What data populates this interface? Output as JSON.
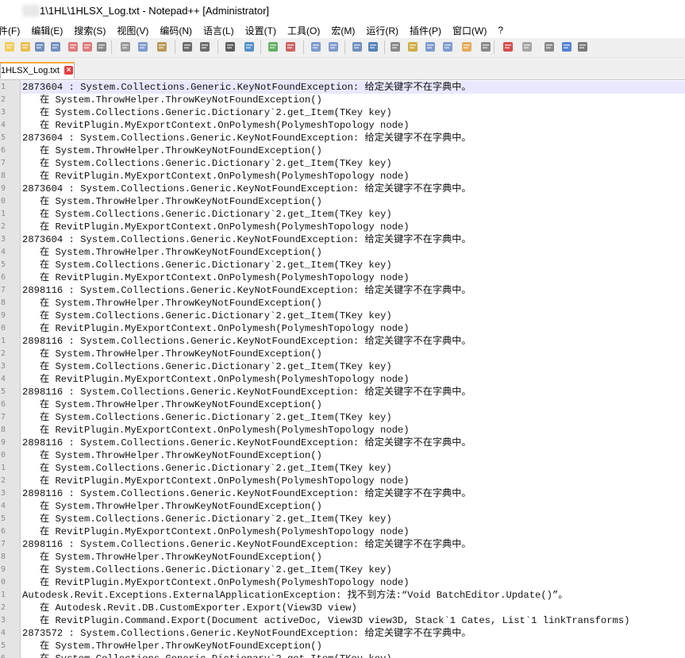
{
  "window": {
    "title": "1\\1HL\\1HLSX_Log.txt - Notepad++ [Administrator]"
  },
  "menu": [
    "件(F)",
    "编辑(E)",
    "搜索(S)",
    "视图(V)",
    "编码(N)",
    "语言(L)",
    "设置(T)",
    "工具(O)",
    "宏(M)",
    "运行(R)",
    "插件(P)",
    "窗口(W)",
    "?"
  ],
  "toolbar": {
    "icons": [
      "new-file-icon",
      "open-file-icon",
      "save-icon",
      "save-all-icon",
      "close-icon",
      "close-all-icon",
      "print-icon",
      "cut-icon",
      "copy-icon",
      "paste-icon",
      "undo-icon",
      "redo-icon",
      "find-icon",
      "replace-icon",
      "zoom-in-icon",
      "zoom-out-icon",
      "sync-vertical-icon",
      "sync-horizontal-icon",
      "word-wrap-icon",
      "show-all-chars-icon",
      "indent-guide-icon",
      "udl-icon",
      "doc-map-icon",
      "function-list-icon",
      "folder-workspace-icon",
      "monitor-icon",
      "record-macro-icon",
      "stop-macro-icon",
      "play-macro-icon",
      "run-macro-multiple-icon",
      "save-macro-icon"
    ]
  },
  "tab": {
    "label": "1HLSX_Log.txt",
    "close_symbol": "×"
  },
  "editor": {
    "lines": [
      {
        "n": "1",
        "text": "2873604 : System.Collections.Generic.KeyNotFoundException: 给定关键字不在字典中。"
      },
      {
        "n": "2",
        "text": "   在 System.ThrowHelper.ThrowKeyNotFoundException()"
      },
      {
        "n": "3",
        "text": "   在 System.Collections.Generic.Dictionary`2.get_Item(TKey key)"
      },
      {
        "n": "4",
        "text": "   在 RevitPlugin.MyExportContext.OnPolymesh(PolymeshTopology node)"
      },
      {
        "n": "5",
        "text": "2873604 : System.Collections.Generic.KeyNotFoundException: 给定关键字不在字典中。"
      },
      {
        "n": "6",
        "text": "   在 System.ThrowHelper.ThrowKeyNotFoundException()"
      },
      {
        "n": "7",
        "text": "   在 System.Collections.Generic.Dictionary`2.get_Item(TKey key)"
      },
      {
        "n": "8",
        "text": "   在 RevitPlugin.MyExportContext.OnPolymesh(PolymeshTopology node)"
      },
      {
        "n": "9",
        "text": "2873604 : System.Collections.Generic.KeyNotFoundException: 给定关键字不在字典中。"
      },
      {
        "n": "0",
        "text": "   在 System.ThrowHelper.ThrowKeyNotFoundException()"
      },
      {
        "n": "1",
        "text": "   在 System.Collections.Generic.Dictionary`2.get_Item(TKey key)"
      },
      {
        "n": "2",
        "text": "   在 RevitPlugin.MyExportContext.OnPolymesh(PolymeshTopology node)"
      },
      {
        "n": "3",
        "text": "2873604 : System.Collections.Generic.KeyNotFoundException: 给定关键字不在字典中。"
      },
      {
        "n": "4",
        "text": "   在 System.ThrowHelper.ThrowKeyNotFoundException()"
      },
      {
        "n": "5",
        "text": "   在 System.Collections.Generic.Dictionary`2.get_Item(TKey key)"
      },
      {
        "n": "6",
        "text": "   在 RevitPlugin.MyExportContext.OnPolymesh(PolymeshTopology node)"
      },
      {
        "n": "7",
        "text": "2898116 : System.Collections.Generic.KeyNotFoundException: 给定关键字不在字典中。"
      },
      {
        "n": "8",
        "text": "   在 System.ThrowHelper.ThrowKeyNotFoundException()"
      },
      {
        "n": "9",
        "text": "   在 System.Collections.Generic.Dictionary`2.get_Item(TKey key)"
      },
      {
        "n": "0",
        "text": "   在 RevitPlugin.MyExportContext.OnPolymesh(PolymeshTopology node)"
      },
      {
        "n": "1",
        "text": "2898116 : System.Collections.Generic.KeyNotFoundException: 给定关键字不在字典中。"
      },
      {
        "n": "2",
        "text": "   在 System.ThrowHelper.ThrowKeyNotFoundException()"
      },
      {
        "n": "3",
        "text": "   在 System.Collections.Generic.Dictionary`2.get_Item(TKey key)"
      },
      {
        "n": "4",
        "text": "   在 RevitPlugin.MyExportContext.OnPolymesh(PolymeshTopology node)"
      },
      {
        "n": "5",
        "text": "2898116 : System.Collections.Generic.KeyNotFoundException: 给定关键字不在字典中。"
      },
      {
        "n": "6",
        "text": "   在 System.ThrowHelper.ThrowKeyNotFoundException()"
      },
      {
        "n": "7",
        "text": "   在 System.Collections.Generic.Dictionary`2.get_Item(TKey key)"
      },
      {
        "n": "8",
        "text": "   在 RevitPlugin.MyExportContext.OnPolymesh(PolymeshTopology node)"
      },
      {
        "n": "9",
        "text": "2898116 : System.Collections.Generic.KeyNotFoundException: 给定关键字不在字典中。"
      },
      {
        "n": "0",
        "text": "   在 System.ThrowHelper.ThrowKeyNotFoundException()"
      },
      {
        "n": "1",
        "text": "   在 System.Collections.Generic.Dictionary`2.get_Item(TKey key)"
      },
      {
        "n": "2",
        "text": "   在 RevitPlugin.MyExportContext.OnPolymesh(PolymeshTopology node)"
      },
      {
        "n": "3",
        "text": "2898116 : System.Collections.Generic.KeyNotFoundException: 给定关键字不在字典中。"
      },
      {
        "n": "4",
        "text": "   在 System.ThrowHelper.ThrowKeyNotFoundException()"
      },
      {
        "n": "5",
        "text": "   在 System.Collections.Generic.Dictionary`2.get_Item(TKey key)"
      },
      {
        "n": "6",
        "text": "   在 RevitPlugin.MyExportContext.OnPolymesh(PolymeshTopology node)"
      },
      {
        "n": "7",
        "text": "2898116 : System.Collections.Generic.KeyNotFoundException: 给定关键字不在字典中。"
      },
      {
        "n": "8",
        "text": "   在 System.ThrowHelper.ThrowKeyNotFoundException()"
      },
      {
        "n": "9",
        "text": "   在 System.Collections.Generic.Dictionary`2.get_Item(TKey key)"
      },
      {
        "n": "0",
        "text": "   在 RevitPlugin.MyExportContext.OnPolymesh(PolymeshTopology node)"
      },
      {
        "n": "1",
        "text": "Autodesk.Revit.Exceptions.ExternalApplicationException: 找不到方法:“Void BatchEditor.Update()”。"
      },
      {
        "n": "2",
        "text": "   在 Autodesk.Revit.DB.CustomExporter.Export(View3D view)"
      },
      {
        "n": "3",
        "text": "   在 RevitPlugin.Command.Export(Document activeDoc, View3D view3D, Stack`1 Cates, List`1 linkTransforms)"
      },
      {
        "n": "4",
        "text": "2873572 : System.Collections.Generic.KeyNotFoundException: 给定关键字不在字典中。"
      },
      {
        "n": "5",
        "text": "   在 System.ThrowHelper.ThrowKeyNotFoundException()"
      },
      {
        "n": "6",
        "text": "   在 System.Collections.Generic.Dictionary`2.get_Item(TKey key)"
      }
    ]
  }
}
